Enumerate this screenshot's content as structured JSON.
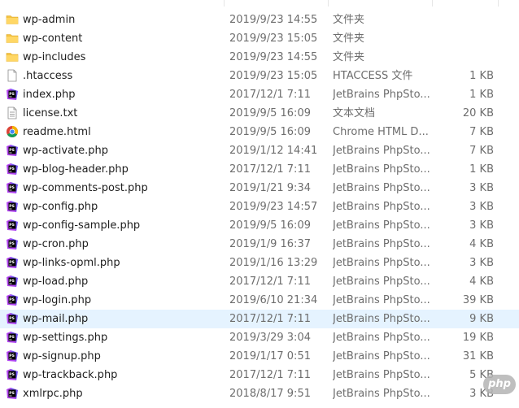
{
  "watermark": "php",
  "colors": {
    "folder": "#f5c342",
    "phpstorm_primary": "#b345f1",
    "phpstorm_secondary": "#765af8",
    "chrome_red": "#db4437",
    "chrome_green": "#0f9d58",
    "chrome_yellow": "#f4b400",
    "chrome_blue": "#4285f4",
    "selection": "#e5f3ff"
  },
  "files": [
    {
      "name": "wp-admin",
      "date": "2019/9/23 14:55",
      "type": "文件夹",
      "size": "",
      "icon": "folder-icon"
    },
    {
      "name": "wp-content",
      "date": "2019/9/23 15:05",
      "type": "文件夹",
      "size": "",
      "icon": "folder-icon"
    },
    {
      "name": "wp-includes",
      "date": "2019/9/23 14:55",
      "type": "文件夹",
      "size": "",
      "icon": "folder-icon"
    },
    {
      "name": ".htaccess",
      "date": "2019/9/23 15:05",
      "type": "HTACCESS 文件",
      "size": "1 KB",
      "icon": "blank-file-icon"
    },
    {
      "name": "index.php",
      "date": "2017/12/1 7:11",
      "type": "JetBrains PhpSto...",
      "size": "1 KB",
      "icon": "phpstorm-icon"
    },
    {
      "name": "license.txt",
      "date": "2019/9/5 16:09",
      "type": "文本文档",
      "size": "20 KB",
      "icon": "text-file-icon"
    },
    {
      "name": "readme.html",
      "date": "2019/9/5 16:09",
      "type": "Chrome HTML D...",
      "size": "7 KB",
      "icon": "chrome-icon"
    },
    {
      "name": "wp-activate.php",
      "date": "2019/1/12 14:41",
      "type": "JetBrains PhpSto...",
      "size": "7 KB",
      "icon": "phpstorm-icon"
    },
    {
      "name": "wp-blog-header.php",
      "date": "2017/12/1 7:11",
      "type": "JetBrains PhpSto...",
      "size": "1 KB",
      "icon": "phpstorm-icon"
    },
    {
      "name": "wp-comments-post.php",
      "date": "2019/1/21 9:34",
      "type": "JetBrains PhpSto...",
      "size": "3 KB",
      "icon": "phpstorm-icon"
    },
    {
      "name": "wp-config.php",
      "date": "2019/9/23 14:57",
      "type": "JetBrains PhpSto...",
      "size": "3 KB",
      "icon": "phpstorm-icon"
    },
    {
      "name": "wp-config-sample.php",
      "date": "2019/9/5 16:09",
      "type": "JetBrains PhpSto...",
      "size": "3 KB",
      "icon": "phpstorm-icon"
    },
    {
      "name": "wp-cron.php",
      "date": "2019/1/9 16:37",
      "type": "JetBrains PhpSto...",
      "size": "4 KB",
      "icon": "phpstorm-icon"
    },
    {
      "name": "wp-links-opml.php",
      "date": "2019/1/16 13:29",
      "type": "JetBrains PhpSto...",
      "size": "3 KB",
      "icon": "phpstorm-icon"
    },
    {
      "name": "wp-load.php",
      "date": "2017/12/1 7:11",
      "type": "JetBrains PhpSto...",
      "size": "4 KB",
      "icon": "phpstorm-icon"
    },
    {
      "name": "wp-login.php",
      "date": "2019/6/10 21:34",
      "type": "JetBrains PhpSto...",
      "size": "39 KB",
      "icon": "phpstorm-icon"
    },
    {
      "name": "wp-mail.php",
      "date": "2017/12/1 7:11",
      "type": "JetBrains PhpSto...",
      "size": "9 KB",
      "icon": "phpstorm-icon",
      "selected": true
    },
    {
      "name": "wp-settings.php",
      "date": "2019/3/29 3:04",
      "type": "JetBrains PhpSto...",
      "size": "19 KB",
      "icon": "phpstorm-icon"
    },
    {
      "name": "wp-signup.php",
      "date": "2019/1/17 0:51",
      "type": "JetBrains PhpSto...",
      "size": "31 KB",
      "icon": "phpstorm-icon"
    },
    {
      "name": "wp-trackback.php",
      "date": "2017/12/1 7:11",
      "type": "JetBrains PhpSto...",
      "size": "5 KB",
      "icon": "phpstorm-icon"
    },
    {
      "name": "xmlrpc.php",
      "date": "2018/8/17 9:51",
      "type": "JetBrains PhpSto...",
      "size": "3 KB",
      "icon": "phpstorm-icon"
    }
  ]
}
